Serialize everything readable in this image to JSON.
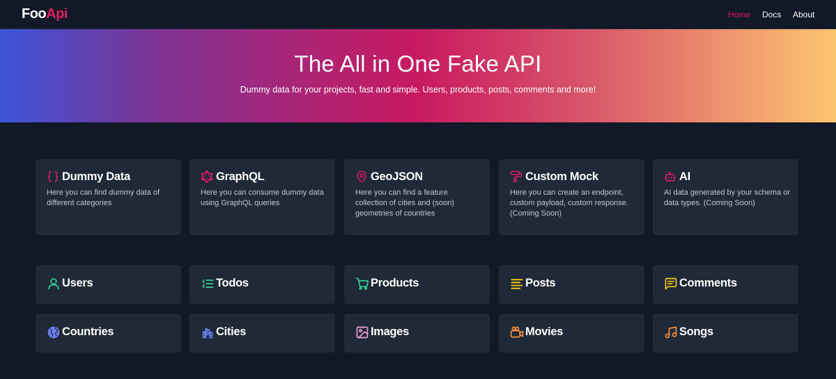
{
  "brand": {
    "part1": "Foo",
    "part2": "Api",
    "accent": "#e11d63"
  },
  "nav": {
    "home": "Home",
    "docs": "Docs",
    "about": "About"
  },
  "hero": {
    "title": "The All in One Fake API",
    "subtitle": "Dummy data for your projects, fast and simple. Users, products, posts, comments and more!"
  },
  "features": [
    {
      "title": "Dummy Data",
      "desc": "Here you can find dummy data of different categories",
      "icon": "curly-braces-icon"
    },
    {
      "title": "GraphQL",
      "desc": "Here you can consume dummy data using GraphQL queries",
      "icon": "graphql-icon"
    },
    {
      "title": "GeoJSON",
      "desc": "Here you can find a feature collection of cities and (soon) geometries of countries",
      "icon": "map-pin-icon"
    },
    {
      "title": "Custom Mock",
      "desc": "Here you can create an endpoint, custom payload, custom response. (Coming Soon)",
      "icon": "paint-roller-icon"
    },
    {
      "title": "AI",
      "desc": "AI data generated by your schema or data types. (Coming Soon)",
      "icon": "robot-icon"
    }
  ],
  "resources": [
    {
      "title": "Users",
      "icon": "user-icon",
      "color": "#34d399"
    },
    {
      "title": "Todos",
      "icon": "list-ordered-icon",
      "color": "#34d399"
    },
    {
      "title": "Products",
      "icon": "shopping-cart-icon",
      "color": "#34d399"
    },
    {
      "title": "Posts",
      "icon": "align-left-icon",
      "color": "#facc15"
    },
    {
      "title": "Comments",
      "icon": "message-square-icon",
      "color": "#facc15"
    },
    {
      "title": "Countries",
      "icon": "globe-icon",
      "color": "#6c7ff2"
    },
    {
      "title": "Cities",
      "icon": "buildings-icon",
      "color": "#6c7ff2"
    },
    {
      "title": "Images",
      "icon": "image-icon",
      "color": "#f0a1d3"
    },
    {
      "title": "Movies",
      "icon": "video-icon",
      "color": "#fb923c"
    },
    {
      "title": "Songs",
      "icon": "music-icon",
      "color": "#fb923c"
    }
  ]
}
